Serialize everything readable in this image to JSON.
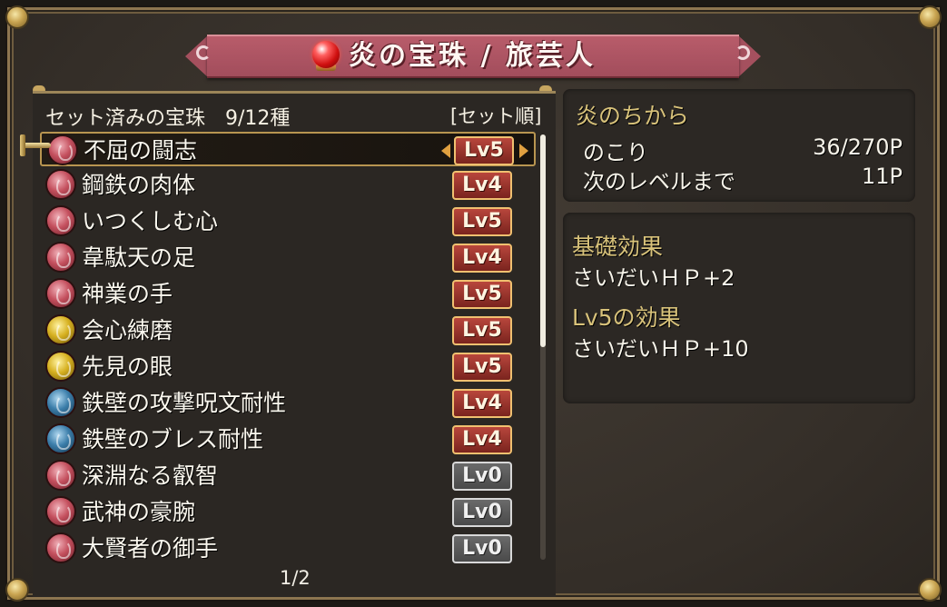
{
  "title": "炎の宝珠 / 旅芸人",
  "list": {
    "header_left": "セット済みの宝珠　9/12種",
    "header_right": "[セット順]",
    "items": [
      {
        "name": "不屈の闘志",
        "level": "Lv5",
        "color": "red",
        "active": true
      },
      {
        "name": "鋼鉄の肉体",
        "level": "Lv4",
        "color": "red",
        "active": true
      },
      {
        "name": "いつくしむ心",
        "level": "Lv5",
        "color": "red",
        "active": true
      },
      {
        "name": "韋駄天の足",
        "level": "Lv4",
        "color": "red",
        "active": true
      },
      {
        "name": "神業の手",
        "level": "Lv5",
        "color": "red",
        "active": true
      },
      {
        "name": "会心練磨",
        "level": "Lv5",
        "color": "yellow",
        "active": true
      },
      {
        "name": "先見の眼",
        "level": "Lv5",
        "color": "yellow",
        "active": true
      },
      {
        "name": "鉄壁の攻撃呪文耐性",
        "level": "Lv4",
        "color": "blue",
        "active": true
      },
      {
        "name": "鉄壁のブレス耐性",
        "level": "Lv4",
        "color": "blue",
        "active": true
      },
      {
        "name": "深淵なる叡智",
        "level": "Lv0",
        "color": "red",
        "active": false
      },
      {
        "name": "武神の豪腕",
        "level": "Lv0",
        "color": "red",
        "active": false
      },
      {
        "name": "大賢者の御手",
        "level": "Lv0",
        "color": "red",
        "active": false
      }
    ],
    "page": "1/2",
    "scroll_fraction": 0.5
  },
  "power": {
    "heading": "炎のちから",
    "remaining_label": "のこり",
    "remaining_value": "36/270P",
    "next_label": "次のレベルまで",
    "next_value": "11P"
  },
  "effects": {
    "base_heading": "基礎効果",
    "base_text": "さいだいＨＰ+2",
    "level_heading": "Lv5の効果",
    "level_text": "さいだいＨＰ+10"
  },
  "colors": {
    "banner": "#a24d5c",
    "level_active": "#7a241e",
    "level_inactive": "#4a4a4a",
    "heading": "#d8c27a"
  }
}
